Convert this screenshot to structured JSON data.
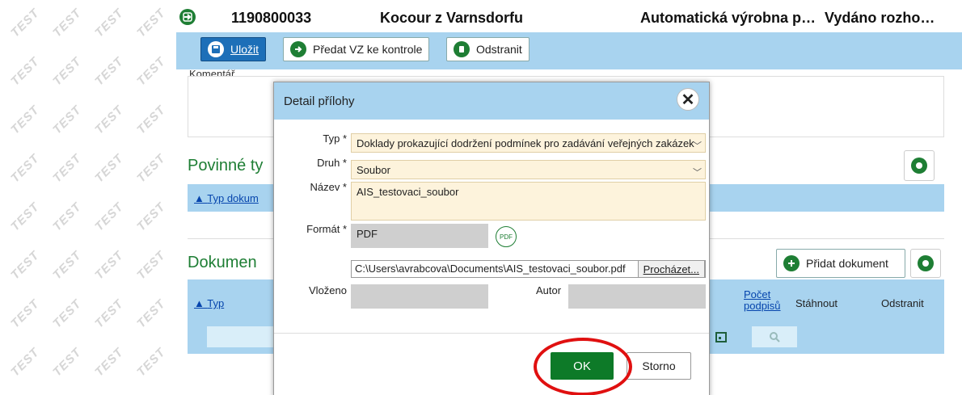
{
  "watermark_text": "TEST",
  "header": {
    "id": "1190800033",
    "name": "Kocour z Varnsdorfu",
    "process": "Automatická výrobna p…",
    "status": "Vydáno rozho…"
  },
  "toolbar": {
    "save_label": "Uložit",
    "submit_label": "Předat VZ ke kontrole",
    "delete_label": "Odstranit"
  },
  "main": {
    "comment_label": "Komentář",
    "required_types_title": "Povinné ty",
    "required_col_type": "Typ dokum",
    "documents_title": "Dokumen",
    "add_document_label": "Přidat dokument",
    "columns": {
      "type": "Typ",
      "signature_count": "Počet podpisů",
      "download": "Stáhnout",
      "remove": "Odstranit"
    }
  },
  "modal": {
    "title": "Detail přílohy",
    "type_label": "Typ *",
    "type_value": "Doklady prokazující dodržení podmínek pro zadávání veřejných zakázek",
    "kind_label": "Druh *",
    "kind_value": "Soubor",
    "name_label": "Název *",
    "name_value": "AIS_testovaci_soubor",
    "format_label": "Formát *",
    "format_value": "PDF",
    "format_badge": "PDF",
    "file_path": "C:\\Users\\avrabcova\\Documents\\AIS_testovaci_soubor.pdf",
    "browse_label": "Procházet...",
    "inserted_label": "Vloženo",
    "inserted_value": "",
    "author_label": "Autor",
    "author_value": "",
    "ok_label": "OK",
    "cancel_label": "Storno"
  },
  "colors": {
    "accent_green": "#1e7e34",
    "toolbar_blue": "#a8d3ef",
    "highlight_red": "#e01010"
  }
}
